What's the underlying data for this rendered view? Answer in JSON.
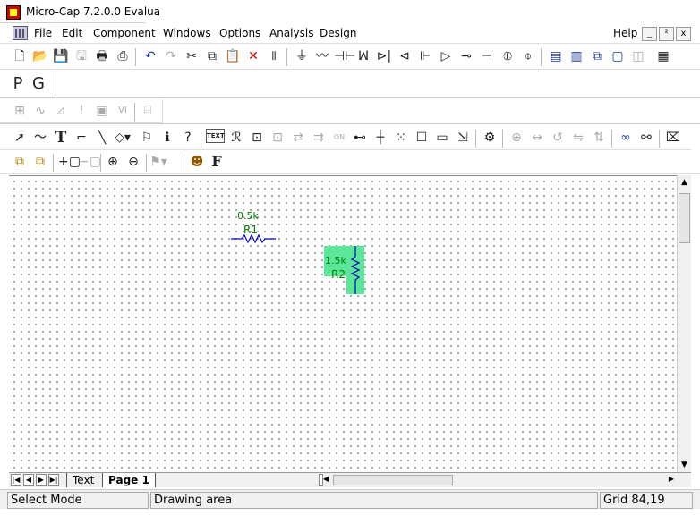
{
  "window": {
    "title": "Micro-Cap 7.2.0.0 Evalua"
  },
  "menu": {
    "items": [
      "File",
      "Edit",
      "Component",
      "Windows",
      "Options",
      "Analysis",
      "Design"
    ],
    "help": "Help",
    "window_controls": {
      "minimize": "_",
      "restore": "²",
      "close": "x"
    }
  },
  "toolbar_pg": {
    "p_label": "P",
    "g_label": "G"
  },
  "toolbar_draw": {
    "text_label": "T",
    "text_mode_label": "TEXT",
    "on_label": "ON",
    "font_label": "F"
  },
  "canvas": {
    "label": "Drawing area",
    "components": [
      {
        "name": "R1",
        "value": "0.5k",
        "orientation": "horizontal",
        "selected": false,
        "color": "#008000"
      },
      {
        "name": "R2",
        "value": "1.5k",
        "orientation": "vertical",
        "selected": true,
        "color": "#008000",
        "highlight": "#5ce69a"
      }
    ]
  },
  "tabs": {
    "text_tab": "Text",
    "page_tab": "Page 1"
  },
  "status": {
    "mode": "Select Mode",
    "area": "Drawing area",
    "grid": "Grid 84,19"
  }
}
